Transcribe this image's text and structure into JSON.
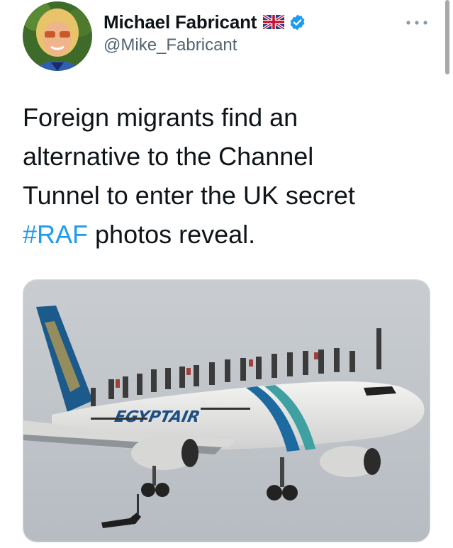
{
  "author": {
    "display_name": "Michael Fabricant",
    "handle": "@Mike_Fabricant",
    "flag_icon": "uk-flag-icon",
    "verified_icon": "verified-badge-icon",
    "avatar": "avatar-photo",
    "verified_color": "#1d9bf0"
  },
  "more_icon": "more-options-icon",
  "tweet": {
    "lines": [
      "Foreign migrants find an",
      "alternative to the Channel",
      "Tunnel to enter the UK secret"
    ],
    "hashtag": "#RAF",
    "line4_rest": " photos reveal."
  },
  "media": {
    "image": "airplane-photo",
    "airline_logo_text": "EGYPTAIR"
  },
  "colors": {
    "text": "#0f1419",
    "secondary": "#536471",
    "link": "#1d9bf0"
  }
}
